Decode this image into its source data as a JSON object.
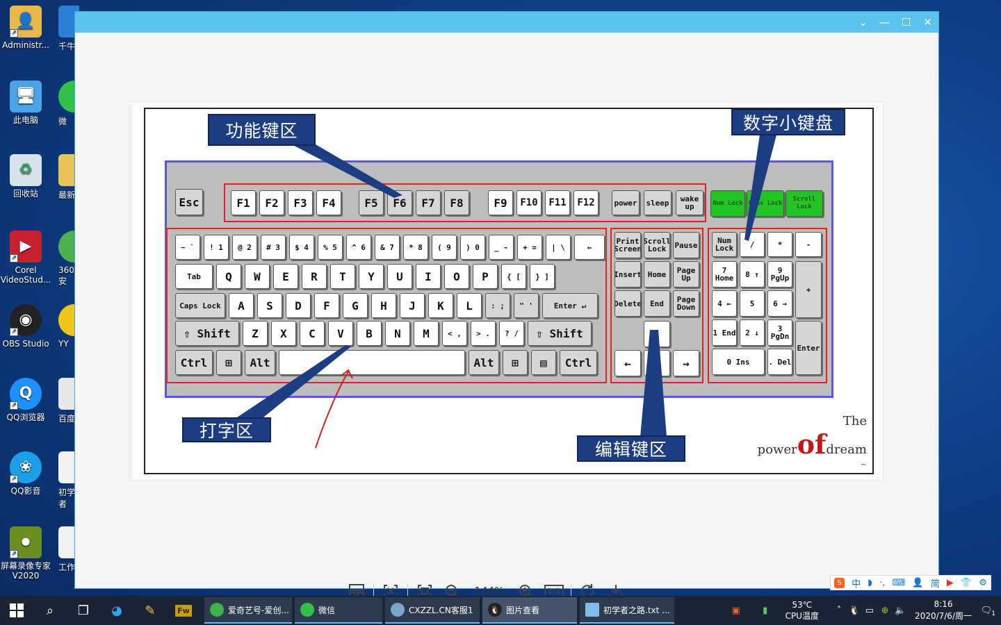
{
  "desktop": {
    "icons": [
      {
        "label": "Administr...",
        "glyph": "user-folder-icon"
      },
      {
        "label": "此电脑",
        "glyph": "computer-icon"
      },
      {
        "label": "回收站",
        "glyph": "recycle-bin-icon"
      },
      {
        "label": "Corel VideoStud...",
        "glyph": "corel-icon"
      },
      {
        "label": "OBS Studio",
        "glyph": "obs-icon"
      },
      {
        "label": "QQ浏览器",
        "glyph": "qq-browser-icon"
      },
      {
        "label": "QQ影音",
        "glyph": "qq-player-icon"
      },
      {
        "label": "屏幕录像专家V2020",
        "glyph": "screen-recorder-icon"
      }
    ],
    "partial_icons": [
      {
        "label": "千牛"
      },
      {
        "label": "微"
      },
      {
        "label": "最新"
      },
      {
        "label": "360安"
      },
      {
        "label": "YY"
      },
      {
        "label": "百度"
      },
      {
        "label": "初学者"
      },
      {
        "label": "工作"
      }
    ]
  },
  "viewer": {
    "window_controls": {
      "dropdown": "⌄",
      "minimize": "—",
      "maximize": "☐",
      "close": "✕"
    },
    "image": {
      "callouts": {
        "function_keys": "功能键区",
        "numpad": "数字小键盘",
        "typing": "打字区",
        "editing": "编辑键区"
      },
      "signature": {
        "the": "The",
        "power": "power",
        "of": "of",
        "dream": "dream"
      },
      "keys": {
        "esc": "Esc",
        "f": [
          "F1",
          "F2",
          "F3",
          "F4",
          "F5",
          "F6",
          "F7",
          "F8",
          "F9",
          "F10",
          "F11",
          "F12"
        ],
        "power": "power",
        "sleep": "sleep",
        "wake": "wake up",
        "leds": [
          "Num Lock",
          "Caps Lock",
          "Scroll Lock"
        ],
        "row1": [
          "~ `",
          "! 1",
          "@ 2",
          "# 3",
          "$ 4",
          "% 5",
          "^ 6",
          "& 7",
          "* 8",
          "( 9",
          ") 0",
          "_ -",
          "+ =",
          "| \\",
          "←"
        ],
        "row2": [
          "Tab",
          "Q",
          "W",
          "E",
          "R",
          "T",
          "Y",
          "U",
          "I",
          "O",
          "P",
          "{ [",
          "} ]"
        ],
        "row3": [
          "Caps Lock",
          "A",
          "S",
          "D",
          "F",
          "G",
          "H",
          "J",
          "K",
          "L",
          ": ;",
          "\" '",
          "Enter ↵"
        ],
        "row4": [
          "⇧ Shift",
          "Z",
          "X",
          "C",
          "V",
          "B",
          "N",
          "M",
          "< ,",
          "> .",
          "? /",
          "⇧ Shift"
        ],
        "row5": [
          "Ctrl",
          "⊞",
          "Alt",
          "",
          "Alt",
          "⊞",
          "▤",
          "Ctrl"
        ],
        "edit": [
          "Print Screen",
          "Scroll Lock",
          "Pause",
          "Insert",
          "Home",
          "Page Up",
          "Delete",
          "End",
          "Page Down",
          "↑",
          "←",
          "↓",
          "→"
        ],
        "numpad": [
          "Num Lock",
          "/",
          "*",
          "-",
          "7 Home",
          "8 ↑",
          "9 PgUp",
          "+",
          "4 ←",
          "5",
          "6 →",
          "1 End",
          "2 ↓",
          "3 PgDn",
          "Enter",
          "0 Ins",
          ". Del"
        ]
      }
    },
    "toolbar": {
      "zoom": "144%",
      "buttons": [
        "layout-icon",
        "fit-icon",
        "fullscreen-icon",
        "zoom-out-icon",
        "zoom-in-icon",
        "actual-size-icon",
        "rotate-icon",
        "download-icon"
      ],
      "actual_size_label": "1:1"
    }
  },
  "ime_bar": {
    "items": [
      "S",
      "中",
      "◗",
      "·,",
      "⌨",
      "👤",
      "简",
      "▶",
      "👕",
      "⚙"
    ]
  },
  "taskbar": {
    "tasks": [
      {
        "label": "爱奇艺号-爱创...",
        "color": "#3fb24a"
      },
      {
        "label": "微信",
        "color": "#2ec14b"
      },
      {
        "label": "CXZZL.CN客服1",
        "color": "#7aa6c9"
      },
      {
        "label": "图片查看",
        "color": "#d33"
      },
      {
        "label": "初学者之路.txt ...",
        "color": "#7fbde8"
      }
    ],
    "temp": {
      "value": "53℃",
      "label": "CPU温度"
    },
    "clock": {
      "time": "8:16",
      "date": "2020/7/6/周一"
    },
    "notification_count": "1"
  }
}
